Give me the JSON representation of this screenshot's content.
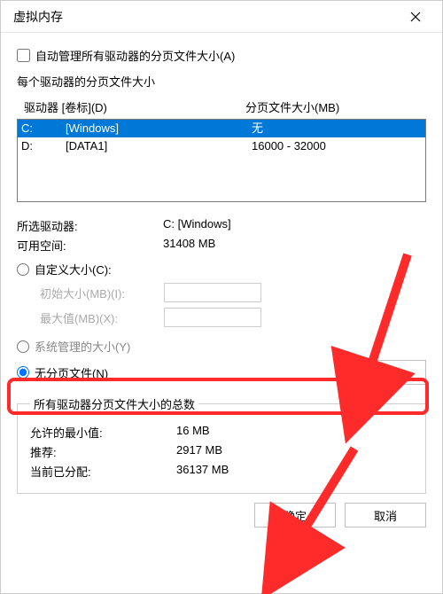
{
  "titlebar": {
    "title": "虚拟内存"
  },
  "autoManage": {
    "label": "自动管理所有驱动器的分页文件大小(A)"
  },
  "perDrive": {
    "heading": "每个驱动器的分页文件大小",
    "col_drive": "驱动器 [卷标](D)",
    "col_pagefile": "分页文件大小(MB)",
    "rows": [
      {
        "drive": "C:",
        "volume": "[Windows]",
        "pagefile": "无",
        "selected": true
      },
      {
        "drive": "D:",
        "volume": "[DATA1]",
        "pagefile": "16000 - 32000",
        "selected": false
      }
    ]
  },
  "selected": {
    "drive_label": "所选驱动器:",
    "drive_value": "C:  [Windows]",
    "free_label": "可用空间:",
    "free_value": "31408 MB"
  },
  "sizeOptions": {
    "custom_label": "自定义大小(C):",
    "initial_label": "初始大小(MB)(I):",
    "max_label": "最大值(MB)(X):",
    "system_label": "系统管理的大小(Y)",
    "none_label": "无分页文件(N)",
    "set_button": "设置(S)"
  },
  "totals": {
    "legend": "所有驱动器分页文件大小的总数",
    "min_label": "允许的最小值:",
    "min_value": "16 MB",
    "rec_label": "推荐:",
    "rec_value": "2917 MB",
    "cur_label": "当前已分配:",
    "cur_value": "36137 MB"
  },
  "footer": {
    "ok": "确定",
    "cancel": "取消"
  }
}
